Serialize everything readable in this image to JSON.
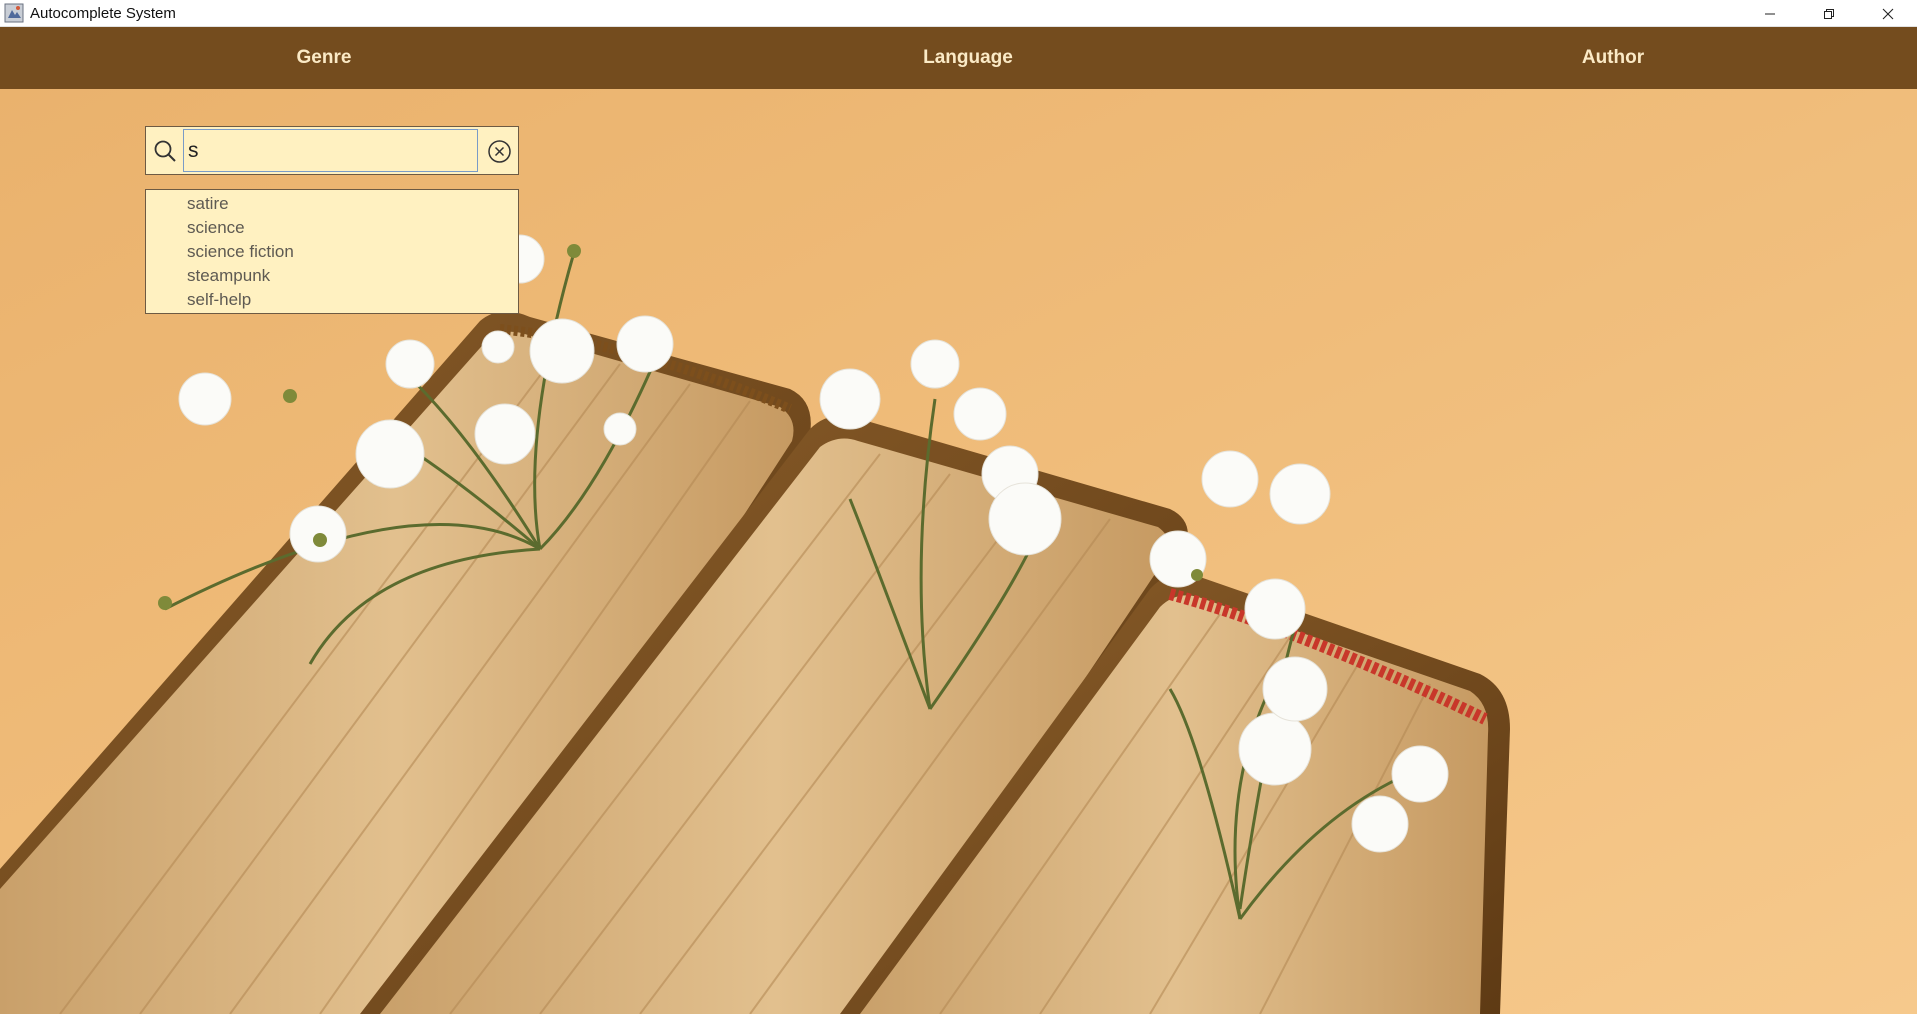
{
  "window": {
    "title": "Autocomplete System"
  },
  "menu": {
    "items": [
      {
        "label": "Genre"
      },
      {
        "label": "Language"
      },
      {
        "label": "Author"
      }
    ]
  },
  "search": {
    "value": "s",
    "placeholder": ""
  },
  "suggestions": [
    "satire",
    "science",
    "science fiction",
    "steampunk",
    "self-help"
  ],
  "colors": {
    "menubar": "#744c1e",
    "menu_text": "#fbeac6",
    "background": "#f0bd78",
    "search_bg": "#fff1c1"
  },
  "background_image": "books-with-white-flowers"
}
